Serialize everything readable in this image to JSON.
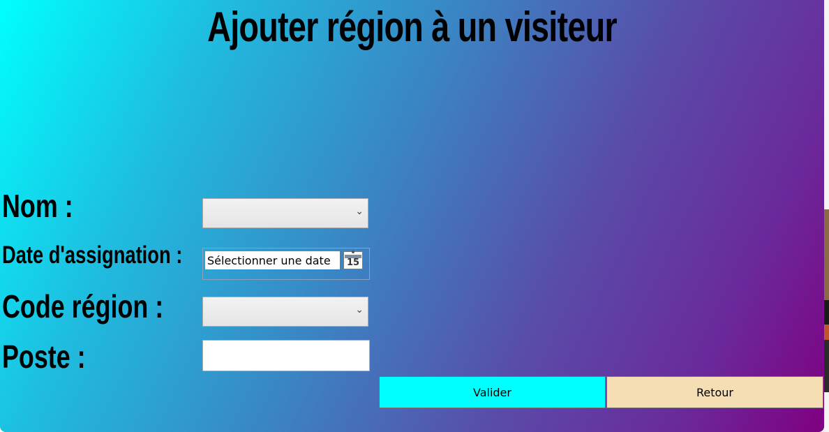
{
  "window": {
    "title": "Ajouter région à un visiteur",
    "gradient_start": "#00ffff",
    "gradient_end": "#800080"
  },
  "form": {
    "nom_label": "Nom :",
    "date_label": "Date d'assignation :",
    "code_region_label": "Code région :",
    "poste_label": "Poste :",
    "nom_value": "",
    "date_placeholder": "Sélectionner une date",
    "calendar_day": "15",
    "code_region_value": "",
    "poste_value": ""
  },
  "buttons": {
    "valider": "Valider",
    "retour": "Retour",
    "valider_color": "#00ffff",
    "retour_color": "#f5deb3"
  },
  "icons": {
    "dropdown": "chevron-down-icon",
    "calendar": "calendar-icon"
  }
}
